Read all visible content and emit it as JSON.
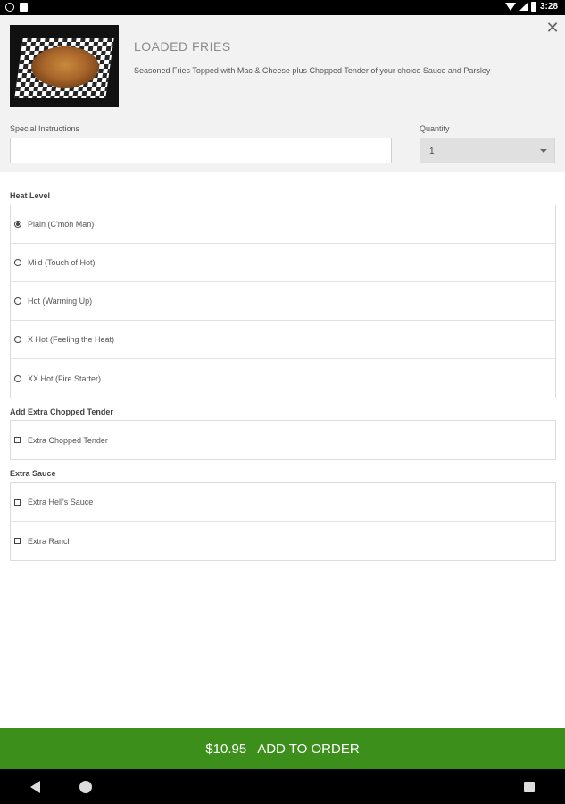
{
  "status_bar": {
    "time": "3:28"
  },
  "item": {
    "title": "LOADED FRIES",
    "description": "Seasoned Fries Topped with Mac & Cheese plus Chopped Tender of your choice Sauce and Parsley"
  },
  "special_instructions": {
    "label": "Special Instructions",
    "value": "",
    "placeholder": ""
  },
  "quantity": {
    "label": "Quantity",
    "value": "1"
  },
  "groups": {
    "heat": {
      "title": "Heat Level",
      "options": [
        {
          "label": "Plain (C'mon Man)",
          "selected": true
        },
        {
          "label": "Mild (Touch of Hot)",
          "selected": false
        },
        {
          "label": "Hot (Warming Up)",
          "selected": false
        },
        {
          "label": "X Hot (Feeling the Heat)",
          "selected": false
        },
        {
          "label": "XX Hot (Fire Starter)",
          "selected": false
        }
      ]
    },
    "tender": {
      "title": "Add Extra Chopped Tender",
      "options": [
        {
          "label": "Extra Chopped Tender",
          "checked": false
        }
      ]
    },
    "sauce": {
      "title": "Extra Sauce",
      "options": [
        {
          "label": "Extra Hell's Sauce",
          "checked": false
        },
        {
          "label": "Extra Ranch",
          "checked": false
        }
      ]
    }
  },
  "order": {
    "price": "$10.95",
    "label": "ADD TO ORDER"
  },
  "colors": {
    "accent": "#3d8f1c",
    "header_bg": "#f2f2f2"
  },
  "icons": [
    "close-icon",
    "radio-icon",
    "checkbox-icon",
    "caret-icon",
    "back-icon",
    "home-icon",
    "recents-icon"
  ]
}
